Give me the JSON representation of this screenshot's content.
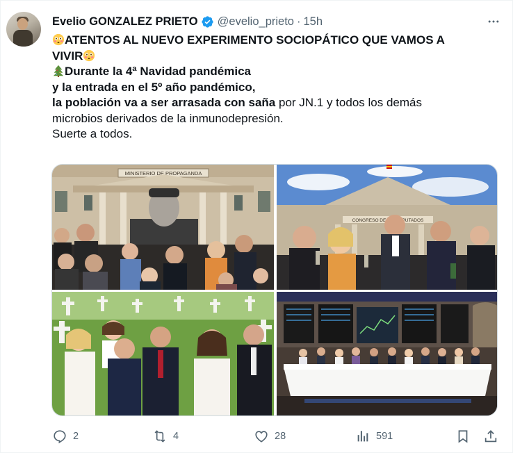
{
  "user": {
    "display_name": "Evelio GONZALEZ PRIETO",
    "handle": "@evelio_prieto",
    "separator": "·",
    "time": "15h"
  },
  "tweet": {
    "line1": "ATENTOS AL NUEVO EXPERIMENTO SOCIOPÁTICO QUE VAMOS A",
    "line2": "VIVIR",
    "line3": "Durante la 4ª Navidad pandémica",
    "line4": "y la entrada en el 5º año pandémico,",
    "line5_bold": "la población va a ser arrasada con saña",
    "line5_rest": " por JN.1 y todos los demás",
    "line6": "microbios derivados de la inmunodepresión.",
    "line7": "Suerte a todos."
  },
  "media": {
    "photo1_sign": "MINISTERIO DE PROPAGANDA",
    "photo2_sign": "CONGRESO DE LOS DIPUTADOS"
  },
  "actions": {
    "replies": "2",
    "reposts": "4",
    "likes": "28",
    "views": "591"
  },
  "colors": {
    "text": "#0f1419",
    "secondary": "#536471",
    "verified": "#1d9bf0",
    "border": "#cfd9de"
  },
  "icons": [
    "verified-badge-icon",
    "more-icon",
    "flushed-face-icon",
    "christmas-tree-icon",
    "reply-icon",
    "repost-icon",
    "like-icon",
    "views-icon",
    "bookmark-icon",
    "share-icon"
  ]
}
